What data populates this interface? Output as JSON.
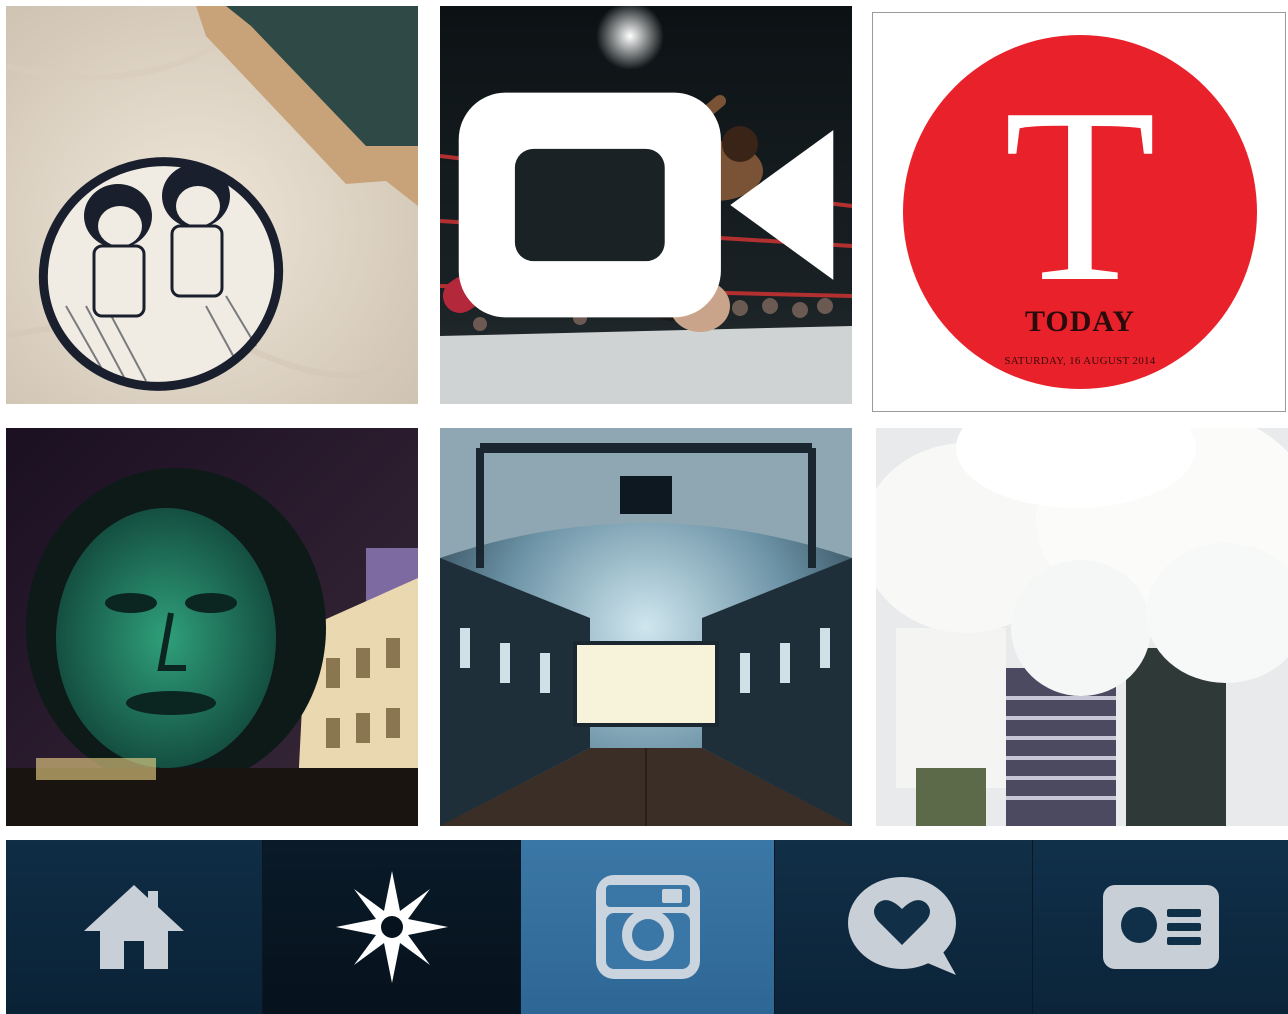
{
  "feed": {
    "tiles": [
      {
        "id": "embroidered-tote",
        "has_video": false
      },
      {
        "id": "wrestling-match",
        "has_video": true
      },
      {
        "id": "today-logo",
        "has_video": false,
        "logo": {
          "letter": "T",
          "wordmark": "TODAY",
          "date": "SATURDAY, 16 AUGUST 2014"
        }
      },
      {
        "id": "projection-face",
        "has_video": false
      },
      {
        "id": "hall-screen",
        "has_video": false
      },
      {
        "id": "balloons-people",
        "has_video": false
      }
    ]
  },
  "tabbar": {
    "items": [
      {
        "name": "home",
        "icon": "home-icon"
      },
      {
        "name": "explore",
        "icon": "star-compass-icon"
      },
      {
        "name": "camera",
        "icon": "camera-icon",
        "active": true
      },
      {
        "name": "activity",
        "icon": "heart-bubble-icon"
      },
      {
        "name": "profile",
        "icon": "profile-card-icon"
      }
    ]
  },
  "colors": {
    "tabbar_dark": "#0f2d45",
    "tabbar_active": "#3b77a6",
    "icon": "#c9cfd6",
    "logo_red": "#e8212a"
  }
}
